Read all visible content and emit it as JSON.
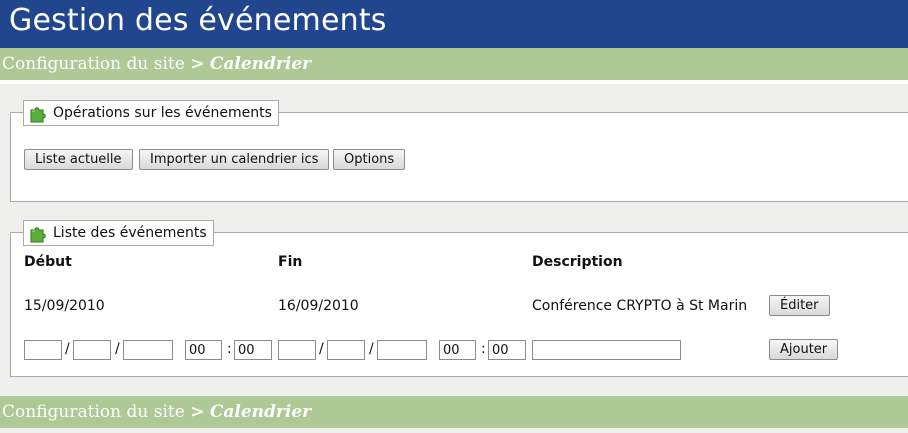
{
  "header": {
    "title": "Gestion des événements"
  },
  "breadcrumb": {
    "parent": "Configuration du site",
    "separator": ">",
    "current": "Calendrier"
  },
  "operations": {
    "legend": "Opérations sur les événements",
    "buttons": {
      "list": "Liste actuelle",
      "import": "Importer un calendrier ics",
      "options": "Options"
    }
  },
  "events": {
    "legend": "Liste des événements",
    "columns": {
      "start": "Début",
      "end": "Fin",
      "description": "Description"
    },
    "rows": [
      {
        "start": "15/09/2010",
        "end": "16/09/2010",
        "description": "Conférence CRYPTO à St Marin",
        "edit_label": "Éditer"
      }
    ],
    "new_row": {
      "date_sep": "/",
      "time_sep": ":",
      "start_hour": "00",
      "start_minute": "00",
      "end_hour": "00",
      "end_minute": "00",
      "add_label": "Ajouter"
    }
  },
  "colors": {
    "header_bg": "#22468d",
    "crumb_bg": "#aec896",
    "page_bg": "#efefed"
  }
}
